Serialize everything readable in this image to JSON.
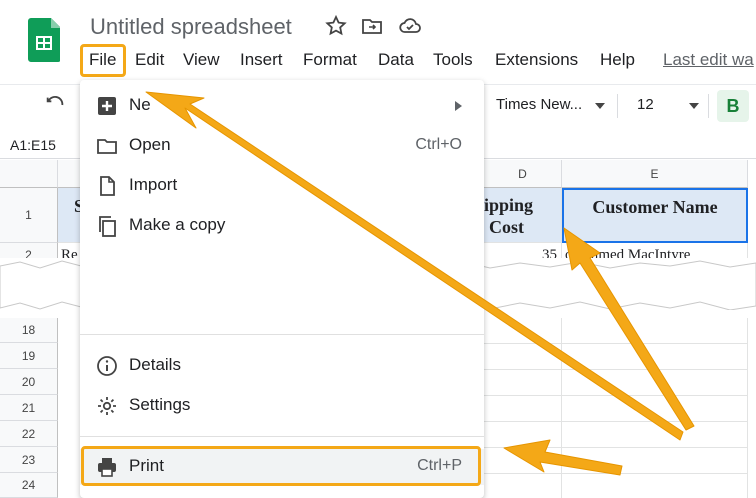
{
  "app": {
    "doc_title": "Untitled spreadsheet",
    "last_edit": "Last edit wa"
  },
  "menubar": [
    "File",
    "Edit",
    "View",
    "Insert",
    "Format",
    "Data",
    "Tools",
    "Extensions",
    "Help"
  ],
  "toolbar": {
    "font_name": "Times New...",
    "font_size": "12",
    "bold_label": "B"
  },
  "formula_bar": {
    "name_box": "A1:E15"
  },
  "grid": {
    "col_headers": [
      "D",
      "E"
    ],
    "header_row": {
      "row": "1",
      "col_a_fragment": "S",
      "col_d_line1": "ipping",
      "col_d_line2": "Cost",
      "col_e": "Customer Name"
    },
    "data_row": {
      "row": "2",
      "col_a_fragment": "Re",
      "col_d": "35",
      "col_e": "ohammed MacIntyre"
    },
    "lower_rows": [
      "18",
      "19",
      "20",
      "21",
      "22",
      "23",
      "24"
    ]
  },
  "file_menu": {
    "items_top": [
      {
        "label": "Ne",
        "icon": "plus-box-icon",
        "submenu": true
      },
      {
        "label": "Open",
        "icon": "folder-icon",
        "shortcut": "Ctrl+O"
      },
      {
        "label": "Import",
        "icon": "file-icon"
      },
      {
        "label": "Make a copy",
        "icon": "copy-icon"
      }
    ],
    "items_bottom": [
      {
        "label": "Details",
        "icon": "info-icon"
      },
      {
        "label": "Settings",
        "icon": "gear-icon"
      }
    ],
    "print": {
      "label": "Print",
      "icon": "printer-icon",
      "shortcut": "Ctrl+P"
    }
  },
  "colors": {
    "highlight": "#f4a817",
    "sheets_green": "#0f9d58",
    "header_fill": "#dde8f5"
  }
}
